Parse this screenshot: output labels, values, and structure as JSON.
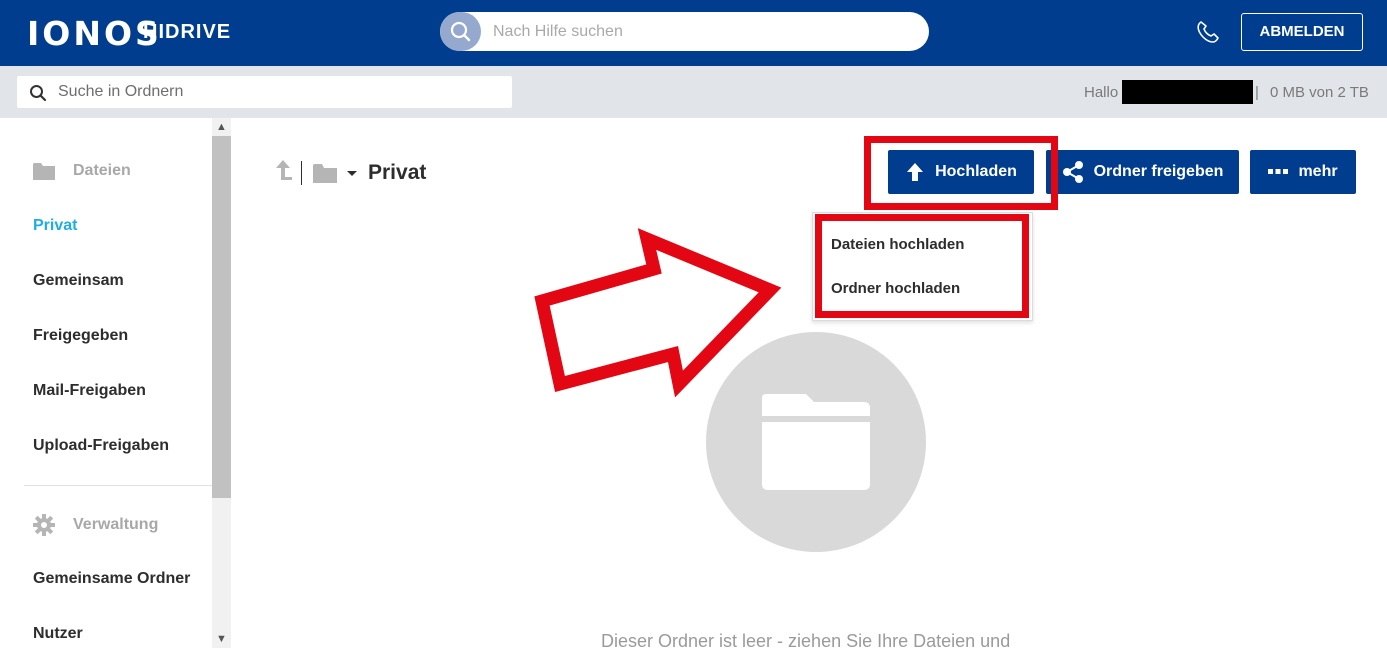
{
  "colors": {
    "header_bg": "#003d8f",
    "accent_active": "#1eaee5",
    "button_bg": "#003d8f",
    "highlight_red": "#e30613",
    "subbar_bg": "#e1e4e8"
  },
  "header": {
    "logo": "IONOS",
    "product": "HIDRIVE",
    "help_search_placeholder": "Nach Hilfe suchen",
    "help_search_icon": "search-icon",
    "phone_icon": "phone-icon",
    "logout_label": "ABMELDEN"
  },
  "subbar": {
    "folder_search_placeholder": "Suche in Ordnern",
    "greeting": "Hallo",
    "separator": "|",
    "quota": "0 MB von 2 TB"
  },
  "sidebar": {
    "section_files": {
      "icon": "folder-icon",
      "label": "Dateien"
    },
    "items": [
      {
        "label": "Privat",
        "active": true
      },
      {
        "label": "Gemeinsam",
        "active": false
      },
      {
        "label": "Freigegeben",
        "active": false
      },
      {
        "label": "Mail-Freigaben",
        "active": false
      },
      {
        "label": "Upload-Freigaben",
        "active": false
      }
    ],
    "section_admin": {
      "icon": "gear-icon",
      "label": "Verwaltung"
    },
    "admin_items": [
      {
        "label": "Gemeinsame Ordner"
      },
      {
        "label": "Nutzer"
      }
    ]
  },
  "toolbar": {
    "up_icon": "arrow-up-icon",
    "folder_icon": "folder-icon",
    "current_folder": "Privat",
    "upload_label": "Hochladen",
    "share_label": "Ordner freigeben",
    "more_label": "mehr"
  },
  "upload_menu": {
    "items": [
      "Dateien hochladen",
      "Ordner hochladen"
    ]
  },
  "empty_state": {
    "icon": "folder-icon",
    "message": "Dieser Ordner ist leer - ziehen Sie Ihre Dateien und"
  }
}
